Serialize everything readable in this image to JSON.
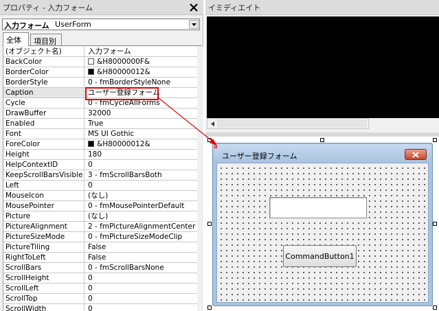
{
  "properties_window": {
    "title": "プロパティ - 入力フォーム",
    "object_name": "入力フォーム",
    "object_type": "UserForm",
    "tabs": [
      {
        "label": "全体"
      },
      {
        "label": "項目別"
      }
    ],
    "rows": [
      {
        "name": "(オブジェクト名)",
        "value": "入力フォーム"
      },
      {
        "name": "BackColor",
        "value": "&H8000000F&",
        "swatch": "#ffffff"
      },
      {
        "name": "BorderColor",
        "value": "&H80000012&",
        "swatch": "#000000"
      },
      {
        "name": "BorderStyle",
        "value": "0 - fmBorderStyleNone"
      },
      {
        "name": "Caption",
        "value": "ユーザー登録フォーム"
      },
      {
        "name": "Cycle",
        "value": "0 - fmCycleAllForms"
      },
      {
        "name": "DrawBuffer",
        "value": "32000"
      },
      {
        "name": "Enabled",
        "value": "True"
      },
      {
        "name": "Font",
        "value": "MS UI Gothic"
      },
      {
        "name": "ForeColor",
        "value": "&H80000012&",
        "swatch": "#000000"
      },
      {
        "name": "Height",
        "value": "180"
      },
      {
        "name": "HelpContextID",
        "value": "0"
      },
      {
        "name": "KeepScrollBarsVisible",
        "value": "3 - fmScrollBarsBoth"
      },
      {
        "name": "Left",
        "value": "0"
      },
      {
        "name": "MouseIcon",
        "value": "(なし)"
      },
      {
        "name": "MousePointer",
        "value": "0 - fmMousePointerDefault"
      },
      {
        "name": "Picture",
        "value": "(なし)"
      },
      {
        "name": "PictureAlignment",
        "value": "2 - fmPictureAlignmentCenter"
      },
      {
        "name": "PictureSizeMode",
        "value": "0 - fmPictureSizeModeClip"
      },
      {
        "name": "PictureTiling",
        "value": "False"
      },
      {
        "name": "RightToLeft",
        "value": "False"
      },
      {
        "name": "ScrollBars",
        "value": "0 - fmScrollBarsNone"
      },
      {
        "name": "ScrollHeight",
        "value": "0"
      },
      {
        "name": "ScrollLeft",
        "value": "0"
      },
      {
        "name": "ScrollTop",
        "value": "0"
      },
      {
        "name": "ScrollWidth",
        "value": "0"
      }
    ]
  },
  "immediate_window": {
    "title": "イミディエイト"
  },
  "userform": {
    "caption": "ユーザー登録フォーム",
    "command_button_label": "CommandButton1"
  },
  "annotation": {
    "highlight_color": "#e00000"
  }
}
